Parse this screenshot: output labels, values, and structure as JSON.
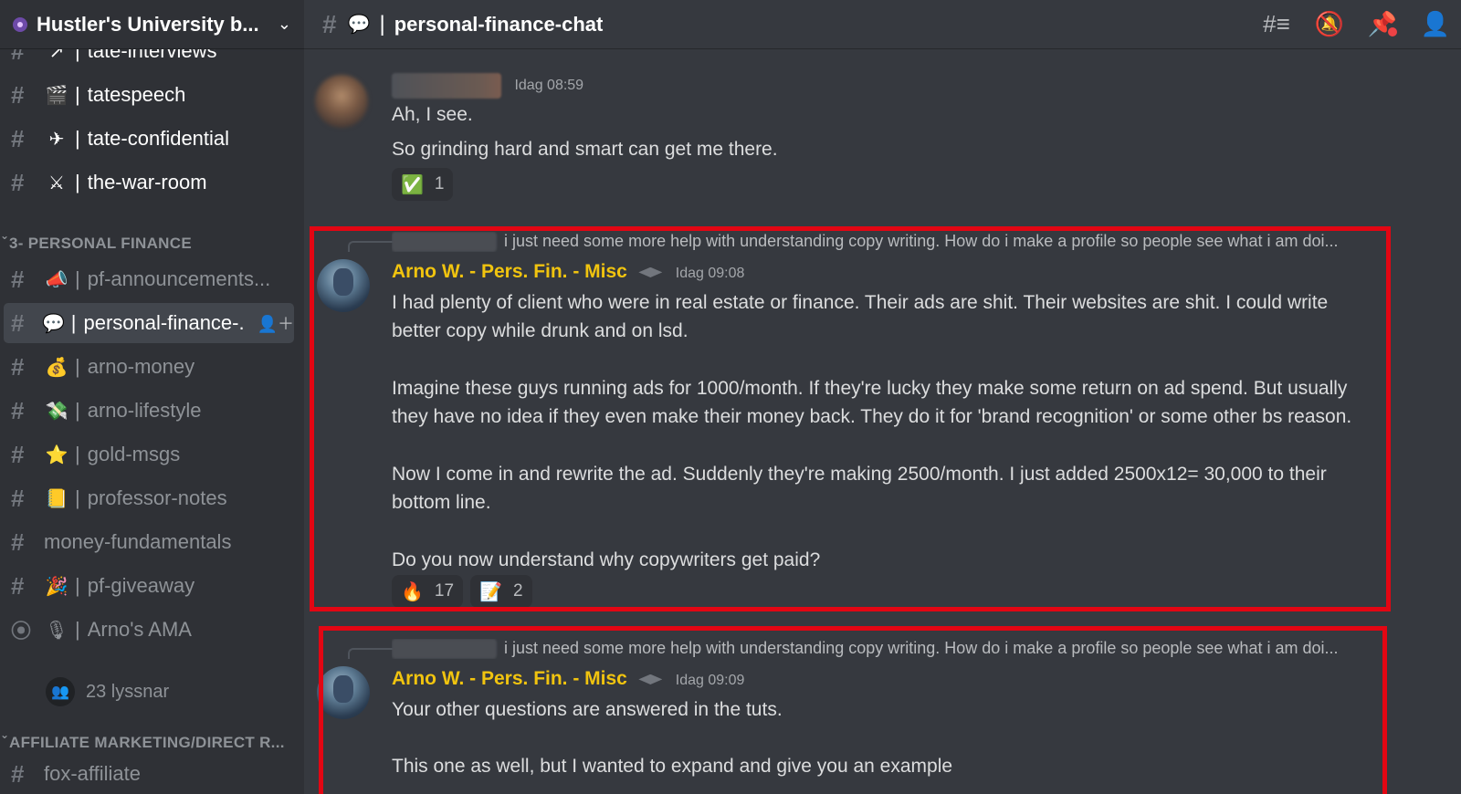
{
  "server": {
    "name": "Hustler's University b...",
    "icon": "server-icon",
    "chevron": "chevron-down-icon"
  },
  "sidebar": {
    "top_channels": [
      {
        "emoji": "↗",
        "label": "tate-interviews"
      },
      {
        "emoji": "🎬",
        "label": "tatespeech"
      },
      {
        "emoji": "✈",
        "label": "tate-confidential"
      },
      {
        "emoji": "⚔",
        "label": "the-war-room"
      }
    ],
    "categories": {
      "personal_finance": "3- PERSONAL FINANCE",
      "affiliate": "AFFILIATE MARKETING/DIRECT R..."
    },
    "pf_channels": [
      {
        "emoji": "📣",
        "label": "pf-announcements..."
      },
      {
        "emoji": "💬",
        "label": "personal-finance-..."
      },
      {
        "emoji": "💰",
        "label": "arno-money"
      },
      {
        "emoji": "💸",
        "label": "arno-lifestyle"
      },
      {
        "emoji": "⭐",
        "label": "gold-msgs"
      },
      {
        "emoji": "📒",
        "label": "professor-notes"
      },
      {
        "emoji": "",
        "label": "money-fundamentals"
      },
      {
        "emoji": "🎉",
        "label": "pf-giveaway"
      },
      {
        "emoji": "🎙",
        "label": "Arno's AMA"
      }
    ],
    "voice_listeners": "23 lyssnar",
    "bottom_channel": "fox-affiliate",
    "hash": "#"
  },
  "topbar": {
    "hash": "#",
    "emoji": "💬",
    "separator": "|",
    "title": "personal-finance-chat",
    "icons": [
      "threads-icon",
      "mute-notifications-icon",
      "pin-icon",
      "member-list-icon"
    ]
  },
  "messages": [
    {
      "time": "Idag 08:59",
      "lines": [
        "Ah, I see.",
        "So grinding hard and smart can get me there."
      ],
      "reactions": [
        {
          "emoji": "✅",
          "count": "1"
        }
      ]
    },
    {
      "reply_text": "i just need some more help with understanding copy writing. How do i make a profile so people see what i am doi...",
      "author": "Arno W. - Pers. Fin. - Misc",
      "time": "Idag 09:08",
      "paragraphs": [
        "I had plenty of client who were in real estate or finance. Their ads are shit. Their websites are shit. I could write better copy while drunk and on lsd.",
        "Imagine these guys running ads for 1000/month. If they're lucky they make some return on ad spend. But usually they have no idea if they even make their money back. They do it for 'brand recognition' or some other bs reason.",
        "Now I come in and rewrite the ad. Suddenly they're making 2500/month. I just added 2500x12= 30,000 to their bottom line.",
        "Do you now understand why copywriters get paid?"
      ],
      "reactions": [
        {
          "emoji": "🔥",
          "count": "17"
        },
        {
          "emoji": "📝",
          "count": "2"
        }
      ]
    },
    {
      "reply_text": "i just need some more help with understanding copy writing. How do i make a profile so people see what i am doi...",
      "author": "Arno W. - Pers. Fin. - Misc",
      "time": "Idag 09:09",
      "paragraphs": [
        "Your other questions are answered in the tuts.",
        "This one as well, but I wanted to expand and give you an example"
      ]
    }
  ],
  "colors": {
    "highlight": "#e30613",
    "author": "#f1c40f",
    "background": "#36393f",
    "sidebar": "#2f3136"
  }
}
